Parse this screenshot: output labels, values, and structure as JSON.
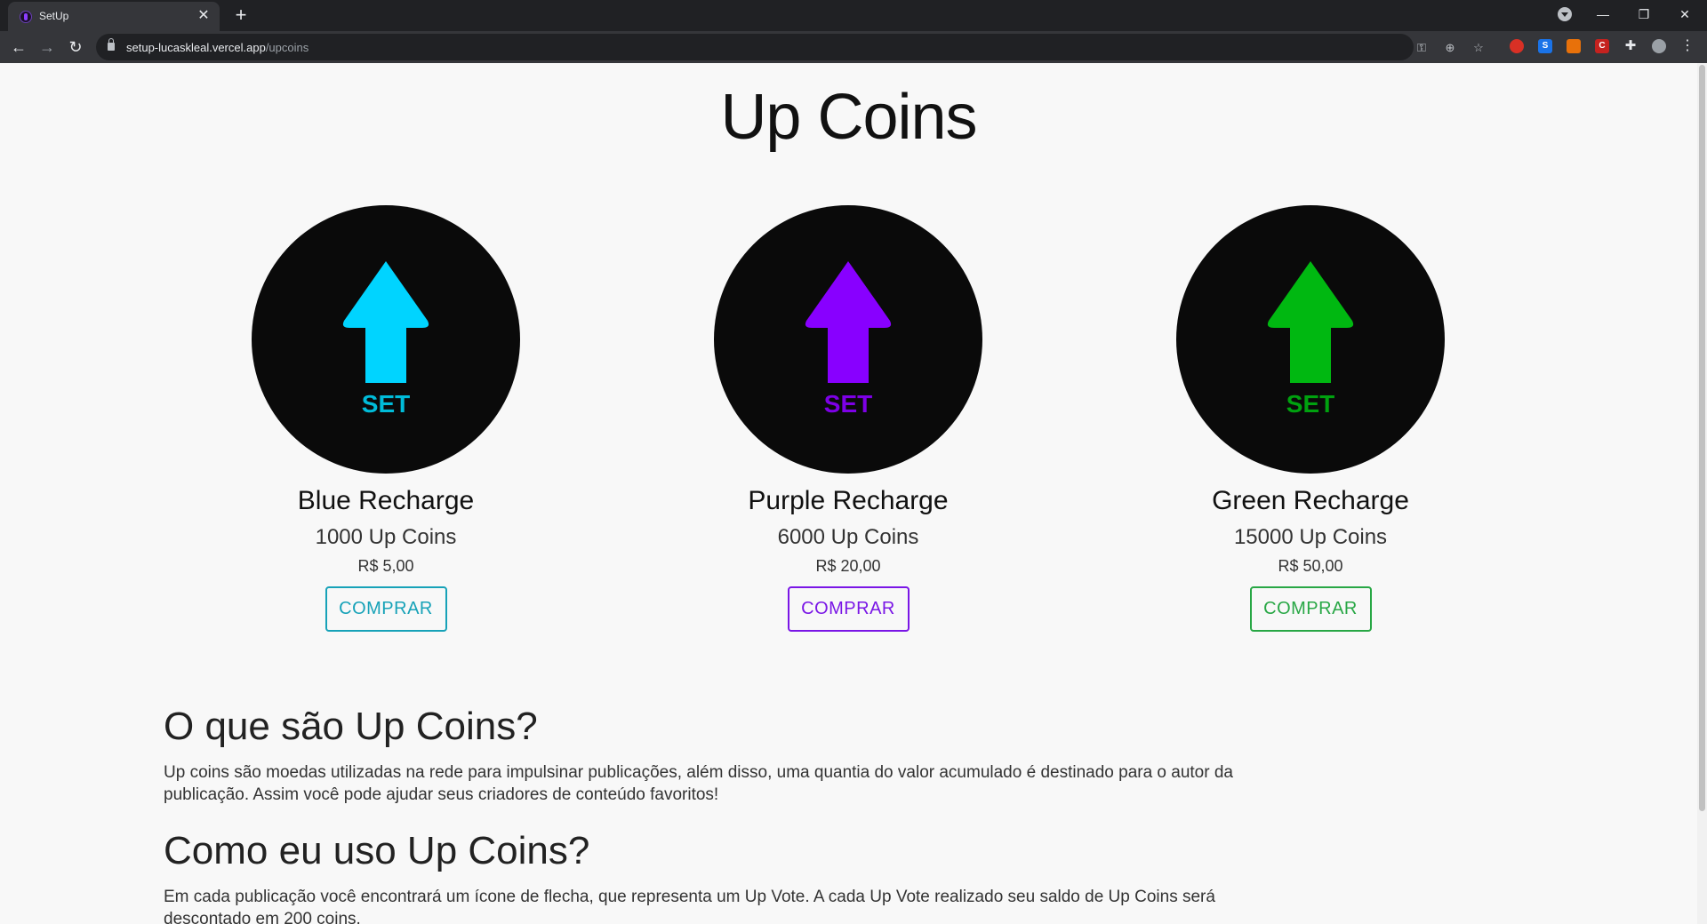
{
  "browser": {
    "tab_title": "SetUp",
    "url_domain": "setup-lucaskleal.vercel.app",
    "url_path": "/upcoins"
  },
  "page": {
    "title": "Up Coins"
  },
  "cards": [
    {
      "name": "Blue Recharge",
      "amount": "1000 Up Coins",
      "price": "R$ 5,00",
      "button": "COMPRAR",
      "color": "#00d4ff",
      "button_color": "#17a2b8",
      "coin_text": "SET",
      "coin_text_color": "#00bcd9"
    },
    {
      "name": "Purple Recharge",
      "amount": "6000 Up Coins",
      "price": "R$ 20,00",
      "button": "COMPRAR",
      "color": "#8800ff",
      "button_color": "#7a16e6",
      "coin_text": "SET",
      "coin_text_color": "#7d00e6"
    },
    {
      "name": "Green Recharge",
      "amount": "15000 Up Coins",
      "price": "R$ 50,00",
      "button": "COMPRAR",
      "color": "#00b811",
      "button_color": "#28a745",
      "coin_text": "SET",
      "coin_text_color": "#00a10f"
    }
  ],
  "sections": [
    {
      "heading": "O que são Up Coins?",
      "body": "Up coins são moedas utilizadas na rede para impulsinar publicações, além disso, uma quantia do valor acumulado é destinado para o autor da publicação. Assim você pode ajudar seus criadores de conteúdo favoritos!"
    },
    {
      "heading": "Como eu uso Up Coins?",
      "body": "Em cada publicação você encontrará um ícone de flecha, que representa um Up Vote. A cada Up Vote realizado seu saldo de Up Coins será descontado em 200 coins."
    }
  ]
}
